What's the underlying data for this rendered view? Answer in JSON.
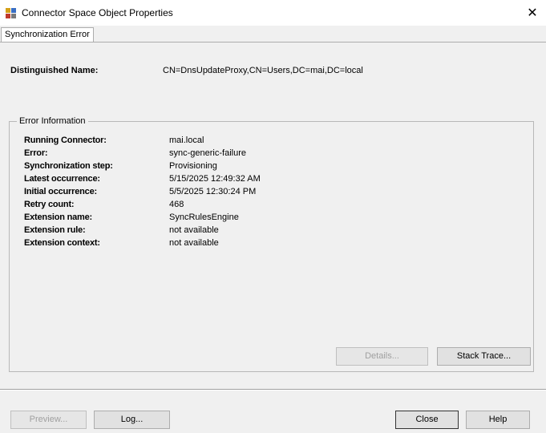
{
  "window": {
    "title": "Connector Space Object Properties",
    "close_glyph": "✕"
  },
  "tabs": [
    {
      "label": "Synchronization Error",
      "selected": true
    }
  ],
  "distinguished_name": {
    "label": "Distinguished Name:",
    "value": "CN=DnsUpdateProxy,CN=Users,DC=mai,DC=local"
  },
  "error_information": {
    "title": "Error Information",
    "rows": [
      {
        "label": "Running Connector:",
        "value": "mai.local"
      },
      {
        "label": "Error:",
        "value": "sync-generic-failure"
      },
      {
        "label": "Synchronization step:",
        "value": "Provisioning"
      },
      {
        "label": "Latest occurrence:",
        "value": "5/15/2025 12:49:32 AM"
      },
      {
        "label": "Initial occurrence:",
        "value": "5/5/2025 12:30:24 PM"
      },
      {
        "label": "Retry count:",
        "value": "468"
      },
      {
        "label": "Extension name:",
        "value": "SyncRulesEngine"
      },
      {
        "label": "Extension rule:",
        "value": "not available"
      },
      {
        "label": "Extension context:",
        "value": "not available"
      }
    ],
    "details_button": {
      "label": "Details...",
      "enabled": false
    },
    "stack_trace_button": {
      "label": "Stack Trace...",
      "enabled": true
    }
  },
  "footer": {
    "preview_button": {
      "label": "Preview...",
      "enabled": false
    },
    "log_button": {
      "label": "Log...",
      "enabled": true
    },
    "close_button": {
      "label": "Close",
      "enabled": true
    },
    "help_button": {
      "label": "Help",
      "enabled": true
    }
  }
}
